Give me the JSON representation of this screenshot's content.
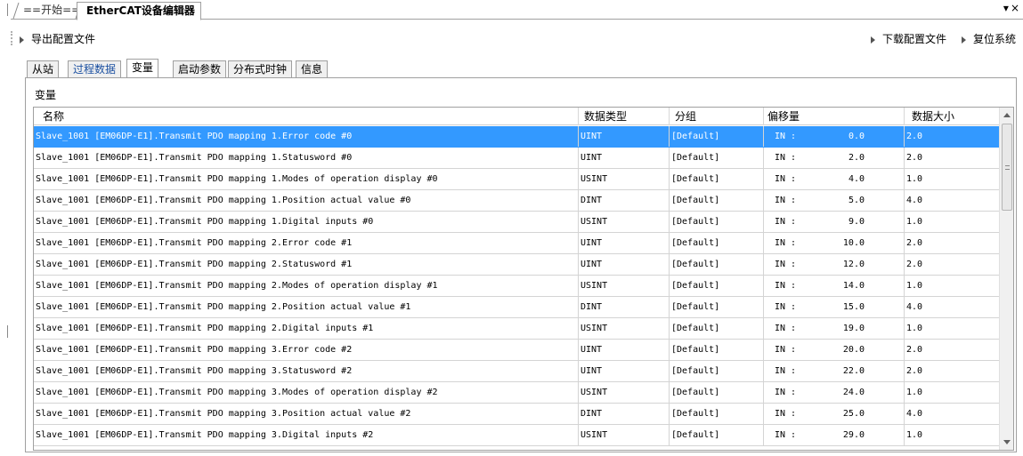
{
  "document_tabs": [
    {
      "label": "==开始=="
    },
    {
      "label": "EtherCAT设备编辑器"
    }
  ],
  "window_controls": {
    "dropdown": "▾",
    "close": "×"
  },
  "toolbar": {
    "export_label": "导出配置文件",
    "download_label": "下载配置文件",
    "reset_label": "复位系统"
  },
  "sub_tabs": [
    {
      "label": "从站"
    },
    {
      "label": "过程数据"
    },
    {
      "label": "变量"
    },
    {
      "label": "启动参数"
    },
    {
      "label": "分布式时钟"
    },
    {
      "label": "信息"
    }
  ],
  "active_sub_tab": "变量",
  "panel": {
    "title": "变量"
  },
  "table": {
    "columns": [
      "名称",
      "数据类型",
      "分组",
      "偏移量",
      "数据大小"
    ],
    "selected_row": 0,
    "rows": [
      {
        "name": "Slave_1001 [EM06DP-E1].Transmit PDO mapping 1.Error code #0",
        "type": "UINT",
        "group": "[Default]",
        "dir": "IN :",
        "offset": "0.0",
        "size": "2.0"
      },
      {
        "name": "Slave_1001 [EM06DP-E1].Transmit PDO mapping 1.Statusword #0",
        "type": "UINT",
        "group": "[Default]",
        "dir": "IN :",
        "offset": "2.0",
        "size": "2.0"
      },
      {
        "name": "Slave_1001 [EM06DP-E1].Transmit PDO mapping 1.Modes of operation display #0",
        "type": "USINT",
        "group": "[Default]",
        "dir": "IN :",
        "offset": "4.0",
        "size": "1.0"
      },
      {
        "name": "Slave_1001 [EM06DP-E1].Transmit PDO mapping 1.Position actual value #0",
        "type": "DINT",
        "group": "[Default]",
        "dir": "IN :",
        "offset": "5.0",
        "size": "4.0"
      },
      {
        "name": "Slave_1001 [EM06DP-E1].Transmit PDO mapping 1.Digital inputs #0",
        "type": "USINT",
        "group": "[Default]",
        "dir": "IN :",
        "offset": "9.0",
        "size": "1.0"
      },
      {
        "name": "Slave_1001 [EM06DP-E1].Transmit PDO mapping 2.Error code #1",
        "type": "UINT",
        "group": "[Default]",
        "dir": "IN :",
        "offset": "10.0",
        "size": "2.0"
      },
      {
        "name": "Slave_1001 [EM06DP-E1].Transmit PDO mapping 2.Statusword #1",
        "type": "UINT",
        "group": "[Default]",
        "dir": "IN :",
        "offset": "12.0",
        "size": "2.0"
      },
      {
        "name": "Slave_1001 [EM06DP-E1].Transmit PDO mapping 2.Modes of operation display #1",
        "type": "USINT",
        "group": "[Default]",
        "dir": "IN :",
        "offset": "14.0",
        "size": "1.0"
      },
      {
        "name": "Slave_1001 [EM06DP-E1].Transmit PDO mapping 2.Position actual value #1",
        "type": "DINT",
        "group": "[Default]",
        "dir": "IN :",
        "offset": "15.0",
        "size": "4.0"
      },
      {
        "name": "Slave_1001 [EM06DP-E1].Transmit PDO mapping 2.Digital inputs #1",
        "type": "USINT",
        "group": "[Default]",
        "dir": "IN :",
        "offset": "19.0",
        "size": "1.0"
      },
      {
        "name": "Slave_1001 [EM06DP-E1].Transmit PDO mapping 3.Error code #2",
        "type": "UINT",
        "group": "[Default]",
        "dir": "IN :",
        "offset": "20.0",
        "size": "2.0"
      },
      {
        "name": "Slave_1001 [EM06DP-E1].Transmit PDO mapping 3.Statusword #2",
        "type": "UINT",
        "group": "[Default]",
        "dir": "IN :",
        "offset": "22.0",
        "size": "2.0"
      },
      {
        "name": "Slave_1001 [EM06DP-E1].Transmit PDO mapping 3.Modes of operation display #2",
        "type": "USINT",
        "group": "[Default]",
        "dir": "IN :",
        "offset": "24.0",
        "size": "1.0"
      },
      {
        "name": "Slave_1001 [EM06DP-E1].Transmit PDO mapping 3.Position actual value #2",
        "type": "DINT",
        "group": "[Default]",
        "dir": "IN :",
        "offset": "25.0",
        "size": "4.0"
      },
      {
        "name": "Slave_1001 [EM06DP-E1].Transmit PDO mapping 3.Digital inputs #2",
        "type": "USINT",
        "group": "[Default]",
        "dir": "IN :",
        "offset": "29.0",
        "size": "1.0"
      }
    ]
  },
  "colors": {
    "selection": "#3399ff",
    "active_tab_text": "#1a4fa0"
  },
  "icons": {
    "toolbar_arrow": "play-arrow-icon",
    "scroll_up": "scroll-up-icon",
    "scroll_down": "scroll-down-icon"
  }
}
